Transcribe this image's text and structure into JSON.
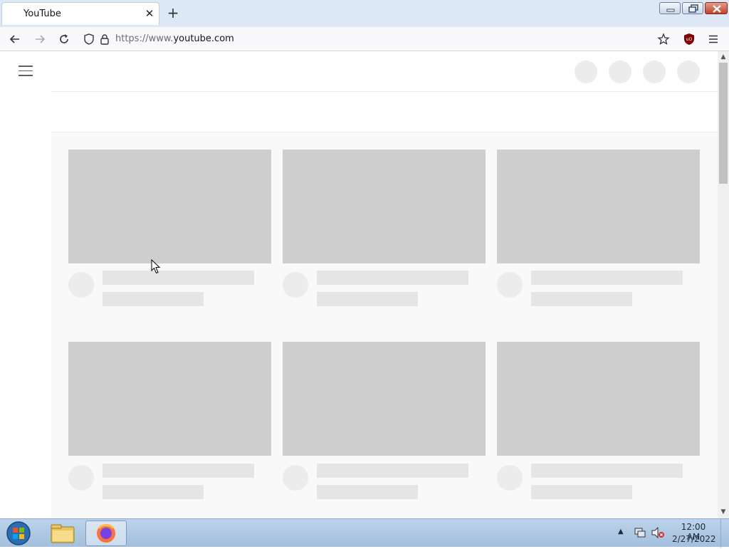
{
  "browser": {
    "tab_title": "YouTube",
    "tab_close": "✕",
    "new_tab": "+",
    "url_prefix": "https://www.",
    "url_domain": "youtube.com"
  },
  "page": {
    "header_placeholders": 4,
    "video_grid": {
      "rows": 2,
      "columns": 3,
      "state": "loading skeleton"
    }
  },
  "taskbar": {
    "time": "12:00 AM",
    "date": "2/27/2022",
    "apps": [
      "explorer",
      "firefox"
    ],
    "active_app": "firefox"
  },
  "icons": {
    "back": "back-arrow-icon",
    "forward": "forward-arrow-icon",
    "reload": "reload-icon",
    "shield": "tracking-shield-icon",
    "lock": "lock-icon",
    "bookmark": "star-icon",
    "ublock": "ublock-origin-icon",
    "menu": "hamburger-menu-icon"
  },
  "colors": {
    "skeleton_thumb": "#cecece",
    "skeleton_text": "#e5e5e5",
    "ublock_red": "#800000"
  }
}
